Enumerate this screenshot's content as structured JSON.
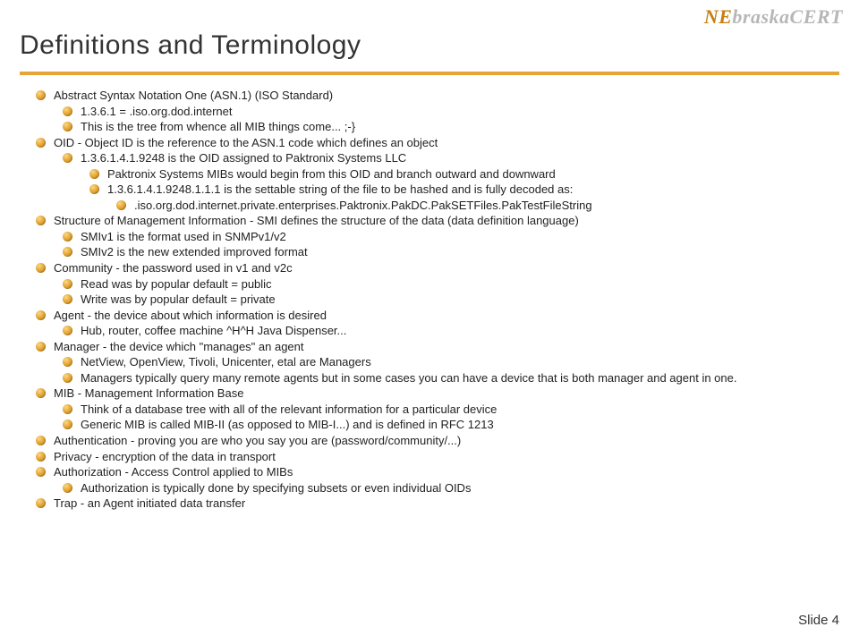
{
  "brand": {
    "part1": "NE",
    "part2": "braskaCERT"
  },
  "title": "Definitions and Terminology",
  "footer": {
    "label": "Slide",
    "num": "4"
  },
  "items": [
    {
      "t": "Abstract Syntax Notation One (ASN.1) (ISO Standard)",
      "c": [
        {
          "t": "1.3.6.1 = .iso.org.dod.internet"
        },
        {
          "t": "This is the tree from whence all MIB things come... ;-}"
        }
      ]
    },
    {
      "t": "OID - Object ID is the reference to the ASN.1 code which defines an object",
      "c": [
        {
          "t": "1.3.6.1.4.1.9248 is the OID assigned to Paktronix Systems LLC",
          "c": [
            {
              "t": "Paktronix Systems MIBs would begin from this OID and branch outward and downward"
            },
            {
              "t": "1.3.6.1.4.1.9248.1.1.1 is the settable string of the file to be hashed and is fully decoded as:",
              "c": [
                {
                  "t": ".iso.org.dod.internet.private.enterprises.Paktronix.PakDC.PakSETFiles.PakTestFileString"
                }
              ]
            }
          ]
        }
      ]
    },
    {
      "t": "Structure of Management Information - SMI defines the structure of the data (data definition language)",
      "c": [
        {
          "t": "SMIv1 is the format used in SNMPv1/v2"
        },
        {
          "t": "SMIv2 is the new extended improved format"
        }
      ]
    },
    {
      "t": "Community - the password used in v1 and v2c",
      "c": [
        {
          "t": "Read was by popular default =  public"
        },
        {
          "t": "Write was by popular default = private"
        }
      ]
    },
    {
      "t": "Agent - the device about which information is desired",
      "c": [
        {
          "t": "Hub, router, coffee machine ^H^H Java Dispenser..."
        }
      ]
    },
    {
      "t": "Manager - the device which \"manages\" an agent",
      "c": [
        {
          "t": "NetView, OpenView, Tivoli, Unicenter, etal are Managers"
        },
        {
          "t": "Managers typically query many remote agents but in some cases you can have a device that is both manager and agent in one."
        }
      ]
    },
    {
      "t": "MIB - Management Information Base",
      "c": [
        {
          "t": "Think of a database tree with all of the relevant information for a particular device"
        },
        {
          "t": "Generic MIB is called MIB-II  (as opposed to MIB-I...)  and is defined in RFC 1213"
        }
      ]
    },
    {
      "t": "Authentication - proving you are who you say you are (password/community/...)"
    },
    {
      "t": "Privacy - encryption of the data in transport"
    },
    {
      "t": "Authorization - Access Control applied to MIBs",
      "c": [
        {
          "t": "Authorization is typically done by specifying subsets or even individual OIDs"
        }
      ]
    },
    {
      "t": "Trap - an Agent initiated data transfer"
    }
  ]
}
